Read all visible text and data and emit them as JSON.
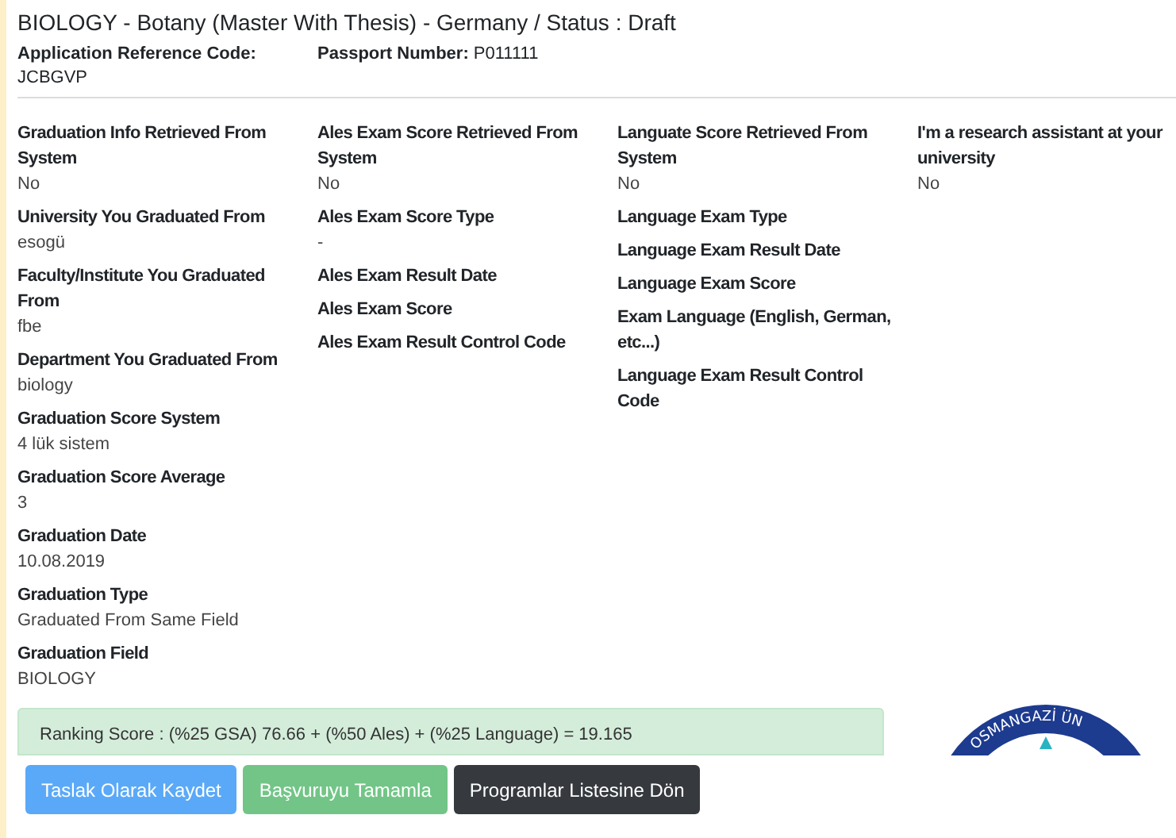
{
  "title": "BIOLOGY - Botany (Master With Thesis) - Germany / Status : Draft",
  "header_fields": [
    {
      "label": "Application Reference Code:",
      "value": "JCBGVP",
      "inline": false
    },
    {
      "label": "Passport Number:",
      "value": "P011111",
      "inline": true
    }
  ],
  "columns": [
    [
      {
        "label": "Graduation Info Retrieved From System",
        "value": "No"
      },
      {
        "label": "University You Graduated From",
        "value": "esogü"
      },
      {
        "label": "Faculty/Institute You Graduated From",
        "value": "fbe"
      },
      {
        "label": "Department You Graduated From",
        "value": "biology"
      },
      {
        "label": "Graduation Score System",
        "value": "4 lük sistem"
      },
      {
        "label": "Graduation Score Average",
        "value": "3"
      },
      {
        "label": "Graduation Date",
        "value": "10.08.2019"
      },
      {
        "label": "Graduation Type",
        "value": "Graduated From Same Field"
      },
      {
        "label": "Graduation Field",
        "value": "BIOLOGY"
      }
    ],
    [
      {
        "label": "Ales Exam Score Retrieved From System",
        "value": "No"
      },
      {
        "label": "Ales Exam Score Type",
        "value": "-"
      },
      {
        "label": "Ales Exam Result Date"
      },
      {
        "label": "Ales Exam Score"
      },
      {
        "label": "Ales Exam Result Control Code"
      }
    ],
    [
      {
        "label": "Languate Score Retrieved From System",
        "value": "No"
      },
      {
        "label": "Language Exam Type"
      },
      {
        "label": "Language Exam Result Date"
      },
      {
        "label": "Language Exam Score"
      },
      {
        "label": "Exam Language (English, German, etc...)"
      },
      {
        "label": "Language Exam Result Control Code"
      }
    ],
    [
      {
        "label": "I'm a research assistant at your university",
        "value": "No"
      }
    ]
  ],
  "ranking_score": "Ranking Score : (%25 GSA) 76.66 + (%50 Ales) + (%25 Language) = 19.165",
  "seal_text": "OSMANGAZİ ÜN",
  "buttons": [
    {
      "label": "Taslak Olarak Kaydet",
      "kind": "primary"
    },
    {
      "label": "Başvuruyu Tamamla",
      "kind": "success"
    },
    {
      "label": "Programlar Listesine Dön",
      "kind": "dark"
    }
  ]
}
